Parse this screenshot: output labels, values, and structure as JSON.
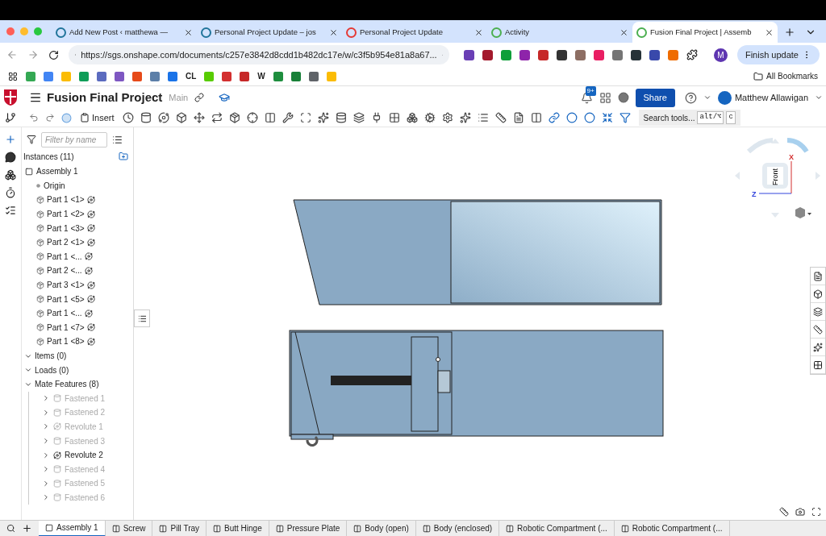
{
  "browser": {
    "tabs": [
      {
        "title": "Add New Post ‹ matthewa —",
        "selected": false
      },
      {
        "title": "Personal Project Update – jos",
        "selected": false
      },
      {
        "title": "Personal Project Update",
        "selected": false
      },
      {
        "title": "Activity",
        "selected": false
      },
      {
        "title": "Fusion Final Project | Assemb",
        "selected": true
      }
    ],
    "url": "https://sgs.onshape.com/documents/c257e3842d8cdd1b482dc17e/w/c3f5b954e81a8a67...",
    "profile_initial": "M",
    "finish_update": "Finish update",
    "all_bookmarks": "All Bookmarks",
    "bookmarks": [
      {
        "kind": "icon",
        "color": "#34a853"
      },
      {
        "kind": "icon",
        "color": "#4285f4"
      },
      {
        "kind": "icon",
        "color": "#fbbc04"
      },
      {
        "kind": "icon",
        "color": "#0f9d58"
      },
      {
        "kind": "icon",
        "color": "#5b6bbf"
      },
      {
        "kind": "icon",
        "color": "#7e57c2"
      },
      {
        "kind": "icon",
        "color": "#e64a19"
      },
      {
        "kind": "icon",
        "color": "#5c7fa8"
      },
      {
        "kind": "icon",
        "color": "#1a73e8"
      },
      {
        "kind": "text",
        "label": "CL"
      },
      {
        "kind": "icon",
        "color": "#58cc02"
      },
      {
        "kind": "icon",
        "color": "#d32f2f"
      },
      {
        "kind": "icon",
        "color": "#c62828"
      },
      {
        "kind": "text",
        "label": "W"
      },
      {
        "kind": "icon",
        "color": "#1e8e3e"
      },
      {
        "kind": "icon",
        "color": "#188038"
      },
      {
        "kind": "icon",
        "color": "#5f6368"
      },
      {
        "kind": "icon",
        "color": "#fbbc04"
      }
    ]
  },
  "app": {
    "title": "Fusion Final Project",
    "branch": "Main",
    "notification_badge": "9+",
    "share": "Share",
    "user": "Matthew Allawigan",
    "insert": "Insert",
    "search_tools": "Search tools...",
    "shortcut_keys": [
      "alt/⌥",
      "c"
    ]
  },
  "tree": {
    "filter_placeholder": "Filter by name",
    "instances_header": "Instances (11)",
    "assembly": "Assembly 1",
    "origin": "Origin",
    "parts": [
      "Part 1 <1>",
      "Part 1 <2>",
      "Part 1 <3>",
      "Part 2 <1>",
      "Part 1 <...",
      "Part 2 <...",
      "Part 3 <1>",
      "Part 1 <5>",
      "Part 1 <...",
      "Part 1 <7>",
      "Part 1 <8>"
    ],
    "sections": [
      {
        "label": "Items (0)",
        "expanded": true
      },
      {
        "label": "Loads (0)",
        "expanded": true
      },
      {
        "label": "Mate Features (8)",
        "expanded": true
      }
    ],
    "mates": [
      {
        "label": "Fastened 1",
        "kind": "fastened",
        "suppressed": true
      },
      {
        "label": "Fastened 2",
        "kind": "fastened",
        "suppressed": true
      },
      {
        "label": "Revolute 1",
        "kind": "revolute",
        "suppressed": true
      },
      {
        "label": "Fastened 3",
        "kind": "fastened",
        "suppressed": true
      },
      {
        "label": "Revolute 2",
        "kind": "revolute",
        "suppressed": false
      },
      {
        "label": "Fastened 4",
        "kind": "fastened",
        "suppressed": true
      },
      {
        "label": "Fastened 5",
        "kind": "fastened",
        "suppressed": true
      },
      {
        "label": "Fastened 6",
        "kind": "fastened",
        "suppressed": true
      }
    ]
  },
  "view_cube": {
    "face": "Front",
    "x_axis": "X",
    "z_axis": "Z"
  },
  "bottom_tabs": [
    {
      "label": "Assembly 1",
      "kind": "assembly",
      "selected": true
    },
    {
      "label": "Screw",
      "kind": "part",
      "selected": false
    },
    {
      "label": "Pill Tray",
      "kind": "part",
      "selected": false
    },
    {
      "label": "Butt Hinge",
      "kind": "part",
      "selected": false
    },
    {
      "label": "Pressure Plate",
      "kind": "part",
      "selected": false
    },
    {
      "label": "Body (open)",
      "kind": "part",
      "selected": false
    },
    {
      "label": "Body (enclosed)",
      "kind": "part",
      "selected": false
    },
    {
      "label": "Robotic Compartment (...",
      "kind": "part",
      "selected": false
    },
    {
      "label": "Robotic Compartment (...",
      "kind": "part",
      "selected": false
    }
  ]
}
